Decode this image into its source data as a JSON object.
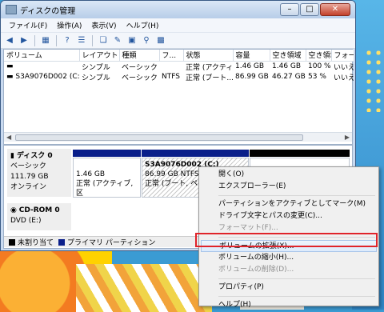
{
  "window": {
    "title": "ディスクの管理"
  },
  "menubar": [
    "ファイル(F)",
    "操作(A)",
    "表示(V)",
    "ヘルプ(H)"
  ],
  "toolbar_icons": [
    "back-icon",
    "forward-icon",
    "view-icon",
    "help-icon",
    "list-icon",
    "new-icon",
    "open-icon",
    "folder-icon",
    "search-icon",
    "properties-icon"
  ],
  "volume_table": {
    "columns": [
      "ボリューム",
      "レイアウト",
      "種類",
      "フ...",
      "状態",
      "容量",
      "空き領域",
      "空き領域",
      "フォー"
    ],
    "rows": [
      [
        "",
        "シンプル",
        "ベーシック",
        "",
        "正常 (アクティ...",
        "1.46 GB",
        "1.46 GB",
        "100 %",
        "いいえ"
      ],
      [
        "S3A9076D002 (C:)",
        "シンプル",
        "ベーシック",
        "NTFS",
        "正常 (ブート...",
        "86.99 GB",
        "46.27 GB",
        "53 %",
        "いいえ"
      ]
    ]
  },
  "disks": {
    "disk0": {
      "name": "ディスク 0",
      "type": "ベーシック",
      "size": "111.79 GB",
      "status": "オンライン"
    },
    "part1": {
      "size": "1.46 GB",
      "status": "正常 (アクティブ, 区"
    },
    "part2": {
      "name": "S3A9076D002 (C:)",
      "size": "86.99 GB NTFS",
      "status": "正常 (ブート, ペー"
    },
    "cdrom": {
      "name": "CD-ROM 0",
      "drive": "DVD (E:)"
    }
  },
  "legend": {
    "unallocated": "未割り当て",
    "primary": "プライマリ パーティション"
  },
  "context_menu": {
    "open": "開く(O)",
    "explore": "エクスプローラー(E)",
    "mark_active": "パーティションをアクティブとしてマーク(M)",
    "change_letter": "ドライブ文字とパスの変更(C)...",
    "format": "フォーマット(F)...",
    "extend": "ボリュームの拡張(X)...",
    "shrink": "ボリュームの縮小(H)...",
    "delete": "ボリュームの削除(D)...",
    "properties": "プロパティ(P)",
    "help": "ヘルプ(H)"
  },
  "colors": {
    "primary_partition": "#0a1f8a",
    "unallocated": "#000000",
    "highlight_box": "#e0242a"
  }
}
